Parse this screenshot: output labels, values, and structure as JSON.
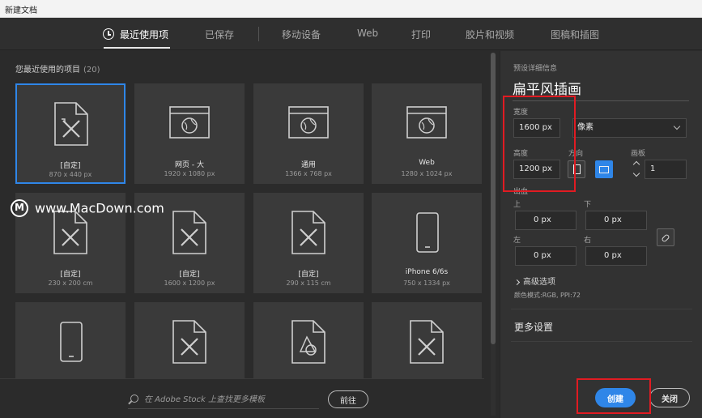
{
  "window": {
    "title": "新建文档"
  },
  "tabs": [
    {
      "label": "最近使用项",
      "active": true
    },
    {
      "label": "已保存"
    },
    {
      "label": "移动设备"
    },
    {
      "label": "Web"
    },
    {
      "label": "打印"
    },
    {
      "label": "胶片和视频"
    },
    {
      "label": "图稿和插图"
    }
  ],
  "recent": {
    "title": "您最近使用的项目",
    "count": "(20)",
    "items": [
      {
        "name": "[自定]",
        "size": "870 x 440 px",
        "icon": "custom-doc-icon"
      },
      {
        "name": "网页 - 大",
        "size": "1920 x 1080 px",
        "icon": "web-page-icon"
      },
      {
        "name": "通用",
        "size": "1366 x 768 px",
        "icon": "web-page-icon"
      },
      {
        "name": "Web",
        "size": "1280 x 1024 px",
        "icon": "web-page-icon"
      },
      {
        "name": "[自定]",
        "size": "230 x 200 cm",
        "icon": "custom-doc-icon"
      },
      {
        "name": "[自定]",
        "size": "1600 x 1200 px",
        "icon": "custom-doc-icon"
      },
      {
        "name": "[自定]",
        "size": "290 x 115 cm",
        "icon": "custom-doc-icon"
      },
      {
        "name": "iPhone 6/6s",
        "size": "750 x 1334 px",
        "icon": "phone-icon"
      },
      {
        "name": "",
        "size": "",
        "icon": "phone-icon"
      },
      {
        "name": "",
        "size": "",
        "icon": "custom-doc-icon"
      },
      {
        "name": "",
        "size": "",
        "icon": "shapes-doc-icon"
      },
      {
        "name": "",
        "size": "",
        "icon": "custom-doc-icon"
      }
    ]
  },
  "stock": {
    "placeholder": "在 Adobe Stock 上查找更多模板",
    "go_label": "前往"
  },
  "watermark": "www.MacDown.com",
  "details": {
    "section_title": "预设详细信息",
    "preset_name": "扁平风插画",
    "width_label": "宽度",
    "width_value": "1600 px",
    "unit": "像素",
    "height_label": "高度",
    "height_value": "1200 px",
    "orientation_label": "方向",
    "artboard_label": "画板",
    "artboard_value": "1",
    "bleed_label": "出血",
    "top_label": "上",
    "top_value": "0 px",
    "bottom_label": "下",
    "bottom_value": "0 px",
    "left_label": "左",
    "left_value": "0 px",
    "right_label": "右",
    "right_value": "0 px",
    "advanced": "高级选项",
    "color_mode": "颜色模式:RGB, PPI:72",
    "more_settings": "更多设置",
    "create_label": "创建",
    "close_label": "关闭"
  },
  "colors": {
    "accent": "#2f86e8",
    "highlight": "#e11b22",
    "panel": "#323232",
    "background": "#2b2b2b"
  }
}
